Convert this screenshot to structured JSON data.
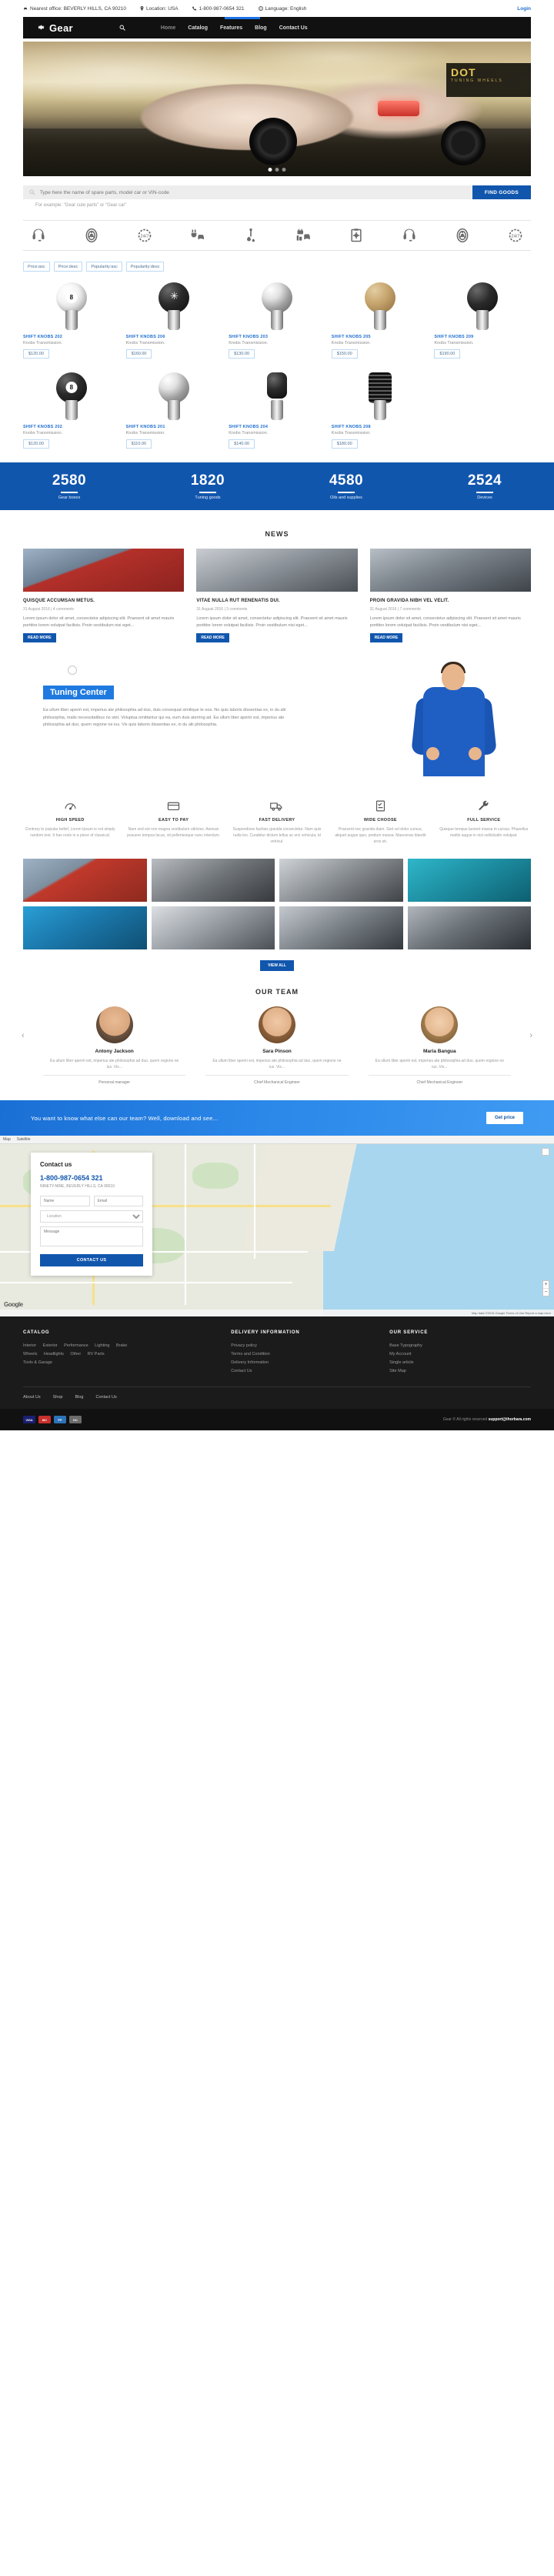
{
  "topbar": {
    "office": "Nearest office: BEVERLY HILLS, CA 90210",
    "location": "Location: USA",
    "phone": "1-800-987-0654 321",
    "language": "Language: English",
    "login": "Login"
  },
  "nav": {
    "brand": "Gear",
    "items": [
      {
        "label": "Home",
        "active": true
      },
      {
        "label": "Catalog",
        "active": false
      },
      {
        "label": "Features",
        "active": false
      },
      {
        "label": "Blog",
        "active": false
      },
      {
        "label": "Contact Us",
        "active": false
      }
    ]
  },
  "hero": {
    "banner_title": "DOT",
    "banner_sub": "TUNING WHEELS"
  },
  "search": {
    "placeholder": "Type here the name of spare parts, model car or VIN-code",
    "button": "FIND GOODS",
    "hint": "For example: \"Gear cute parts\" or \"Gear car\""
  },
  "icon_row": [
    "headset-icon",
    "wheel-icon",
    "247-support-icon",
    "plug-car-icon",
    "oil-dipstick-icon",
    "car-battery-icon",
    "clipboard-gear-icon",
    "headset-icon",
    "wheel-icon",
    "247-support-icon"
  ],
  "sort_tabs": [
    "Price:asc",
    "Price:desc",
    "Popularity:asc",
    "Popularity:desc"
  ],
  "products": [
    {
      "name": "SHIFT KNOBS 202",
      "cat": "Knobs Transmission.",
      "price": "$120.00",
      "style": "white",
      "badge": "8"
    },
    {
      "name": "SHIFT KNOBS 206",
      "cat": "Knobs Transmission.",
      "price": "$160.00",
      "style": "black",
      "badge": "star"
    },
    {
      "name": "SHIFT KNOBS 203",
      "cat": "Knobs Transmission.",
      "price": "$130.00",
      "style": "chrome",
      "badge": ""
    },
    {
      "name": "SHIFT KNOBS 205",
      "cat": "Knobs Transmission.",
      "price": "$150.00",
      "style": "wood",
      "badge": ""
    },
    {
      "name": "SHIFT KNOBS 209",
      "cat": "Knobs Transmission.",
      "price": "$190.00",
      "style": "black",
      "badge": ""
    },
    {
      "name": "SHIFT KNOBS 202",
      "cat": "Knobs Transmission.",
      "price": "$120.00",
      "style": "black",
      "badge": "8"
    },
    {
      "name": "SHIFT KNOBS 201",
      "cat": "Knobs Transmission.",
      "price": "$110.00",
      "style": "chrome",
      "badge": ""
    },
    {
      "name": "SHIFT KNOBS 204",
      "cat": "Knobs Transmission.",
      "price": "$140.00",
      "style": "lever",
      "badge": ""
    },
    {
      "name": "SHIFT KNOBS 208",
      "cat": "Knobs Transmission.",
      "price": "$180.00",
      "style": "ribbed",
      "badge": ""
    }
  ],
  "stats": [
    {
      "n": "2580",
      "l": "Gear boxes"
    },
    {
      "n": "1820",
      "l": "Tuning goods"
    },
    {
      "n": "4580",
      "l": "Oils and supplies"
    },
    {
      "n": "2524",
      "l": "Devices"
    }
  ],
  "news": {
    "title": "NEWS",
    "items": [
      {
        "title": "QUISQUE ACCUMSAN METUS.",
        "meta": "31 August 2016 | 4 comments",
        "body": "Lorem ipsum dolor sit amet, consectetur adipiscing elit. Praesent sit amet mauris porttitor lorem volutpat facilisis. Proin vestibulum nisi eget...",
        "btn": "READ MORE"
      },
      {
        "title": "VITAE NULLA RUT RENENATIS DUI.",
        "meta": "31 August 2016 | 3 comments",
        "body": "Lorem ipsum dolor sit amet, consectetur adipiscing elit. Praesent sit amet mauris porttitor lorem volutpat facilisis. Proin vestibulum nisi eget...",
        "btn": "READ MORE"
      },
      {
        "title": "PROIN GRAVIDA NIBH VEL VELIT.",
        "meta": "31 August 2016 | 7 comments",
        "body": "Lorem ipsum dolor sit amet, consectetur adipiscing elit. Praesent sit amet mauris porttitor lorem volutpat facilisis. Proin vestibulum nisi eget...",
        "btn": "READ MORE"
      }
    ]
  },
  "tuning": {
    "tag": "Tuning Center",
    "body": "Ea ullum liber aperiri est, imperius ate philosophia ad duo, duis consequat similique te eos. No quis laboris dissentias ex, in du alii philosophia, malis necessitatibus no stet. Voluptua omittantur qui ea, eum duis aterring ad. Ea ullum liber aperiri est, imperius ate philosophia ad duo, quem regione ne ius. Vix quis laboris dissentias ex, in du alii philosophia."
  },
  "features": [
    {
      "icon": "speedometer-icon",
      "title": "HIGH SPEED",
      "body": "Contrary to popular belief, Lorem Ipsum is not simply random text. It has roots in a piece of classical."
    },
    {
      "icon": "credit-card-icon",
      "title": "EASY TO PAY",
      "body": "Nam sed est non magna vestibulum ultricies. Aenean posuere tempus lacus, sit pellentesque nunc interdum."
    },
    {
      "icon": "truck-icon",
      "title": "FAST DELIVERY",
      "body": "Suspendisse facilisis gravida consectetur. Nam quis nulla leo. Curabitur dictum tellus ac orci vehicula, id vehicul."
    },
    {
      "icon": "checklist-icon",
      "title": "WIDE CHOOSE",
      "body": "Praesent nec gravida diam. Sed vel dolor cursus, aliquet augue quis, pretium massa. Maecenas blandit eros sit."
    },
    {
      "icon": "wrench-icon",
      "title": "FULL SERVICE",
      "body": "Quisque tempus laoreet massa in cursus. Phasellus mattis augue in nisl sollicitudin volutpat."
    }
  ],
  "gallery": {
    "button": "VIEW ALL",
    "count": 8
  },
  "team": {
    "title": "OUR TEAM",
    "members": [
      {
        "name": "Antony Jackson",
        "bio": "Ea ullum liber aperiri est, imperius ate philosophia ad duo, quem regione ne ius. Vix...",
        "role": "Personal manager"
      },
      {
        "name": "Sara Pinson",
        "bio": "Ea ullum liber aperiri est, imperius ate philosophia ad duo, quem regione ne ius. Vix...",
        "role": "Chief Mechanical Engineer"
      },
      {
        "name": "Maria Bangua",
        "bio": "Ea ullum liber aperiri est, imperius ate philosophia ad duo, quem regione ne ius. Vix...",
        "role": "Chief Mechanical Engineer"
      }
    ]
  },
  "cta": {
    "text": "You want to know what else can our team? Well, download and see...",
    "button": "Get price"
  },
  "map": {
    "topbar": [
      "Map",
      "Satellite"
    ],
    "attribution": "Map data ©2016 Google  Terms of Use  Report a map error",
    "logo": "Google",
    "zoom_in": "+",
    "zoom_out": "−"
  },
  "contact": {
    "title": "Contact us",
    "phone": "1-800-987-0654 321",
    "address": "NINETY-NINE, BEVERLY HILLS, CA 90010",
    "name_placeholder": "Name",
    "email_placeholder": "Email",
    "select_value": "Location",
    "message_placeholder": "Message",
    "button": "CONTACT US"
  },
  "footer": {
    "columns": [
      {
        "title": "CATALOG",
        "type": "tags",
        "rows": [
          [
            "Interior",
            "Exterior",
            "Performance",
            "Lighting",
            "Brake"
          ],
          [
            "Wheels",
            "Headlights",
            "Other",
            "RV Parts"
          ],
          [
            "Tools & Garage"
          ]
        ]
      },
      {
        "title": "DELIVERY INFORMATION",
        "type": "list",
        "items": [
          "Privacy policy",
          "Terms and Condition",
          "Delivery Information",
          "Contact Us"
        ]
      },
      {
        "title": "OUR SERVICE",
        "type": "list",
        "items": [
          "Base Typography",
          "My Account",
          "Single article",
          "Site Map"
        ]
      }
    ],
    "bottom_links": [
      "About Us",
      "Shop",
      "Blog",
      "Contact Us"
    ],
    "payments": [
      "VISA",
      "MC",
      "PP",
      "DC"
    ],
    "copyright_prefix": "Gear © All rights reserved",
    "copyright_support": "support@thorbara.com"
  },
  "colors": {
    "accent": "#1156ad",
    "link": "#1f6fd0",
    "nav_bg": "#111111",
    "footer_bg": "#1b1b1b"
  }
}
